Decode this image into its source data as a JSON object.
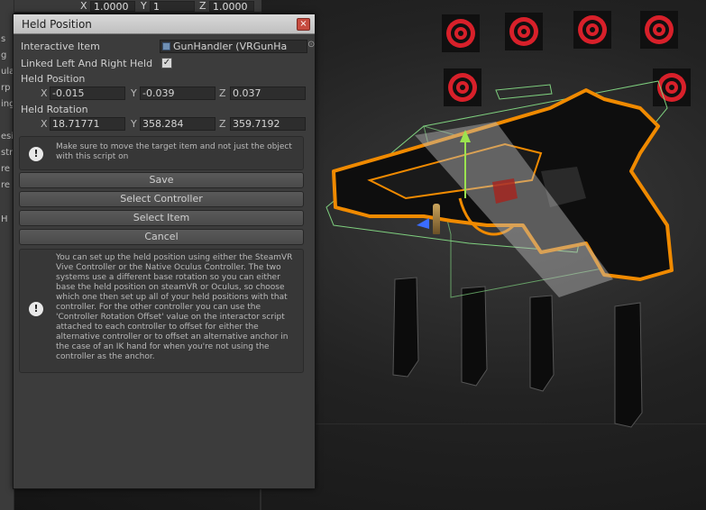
{
  "top_transform": {
    "label_fragment": "le",
    "x_label": "X",
    "x_value": "1.0000",
    "y_label": "Y",
    "y_value": "1",
    "z_label": "Z",
    "z_value": "1.0000"
  },
  "side_fragments": [
    "s",
    "g",
    "ula",
    "rp",
    "ing",
    "esi",
    "str",
    "re",
    "re",
    "H"
  ],
  "dialog": {
    "title": "Held Position",
    "close_glyph": "×",
    "interactive_item": {
      "label": "Interactive Item",
      "value": "GunHandler (VRGunHa",
      "picker_glyph": "⊙"
    },
    "linked": {
      "label": "Linked Left And Right Held",
      "checked": true,
      "check_glyph": "✓"
    },
    "held_position": {
      "label": "Held Position",
      "x_label": "X",
      "x": "-0.015",
      "y_label": "Y",
      "y": "-0.039",
      "z_label": "Z",
      "z": "0.037"
    },
    "held_rotation": {
      "label": "Held Rotation",
      "x_label": "X",
      "x": "18.71771",
      "y_label": "Y",
      "y": "358.284",
      "z_label": "Z",
      "z": "359.7192"
    },
    "help1": "Make sure to move the target item and not just the object with this script on",
    "buttons": {
      "save": "Save",
      "select_controller": "Select Controller",
      "select_item": "Select Item",
      "cancel": "Cancel"
    },
    "help2": "You can set up the held position using either the SteamVR Vive Controller or the Native Oculus Controller. The two systems use a different base rotation so you can either base the held position on steamVR or Oculus, so choose which one then set up all of your held positions with that controller. For the other controller you can use the 'Controller Rotation Offset' value on the interactor script attached to each controller to offset for either the alternative controller or to offset an alternative anchor in the case of an IK hand for when you're not using the controller as the anchor.",
    "help_icon_glyph": "!"
  },
  "colors": {
    "highlight_orange": "#f08a00",
    "target_red": "#d8202a",
    "bounds_green": "#7fd07f",
    "gizmo_green": "#9be34f",
    "gizmo_blue": "#3a6cff"
  }
}
